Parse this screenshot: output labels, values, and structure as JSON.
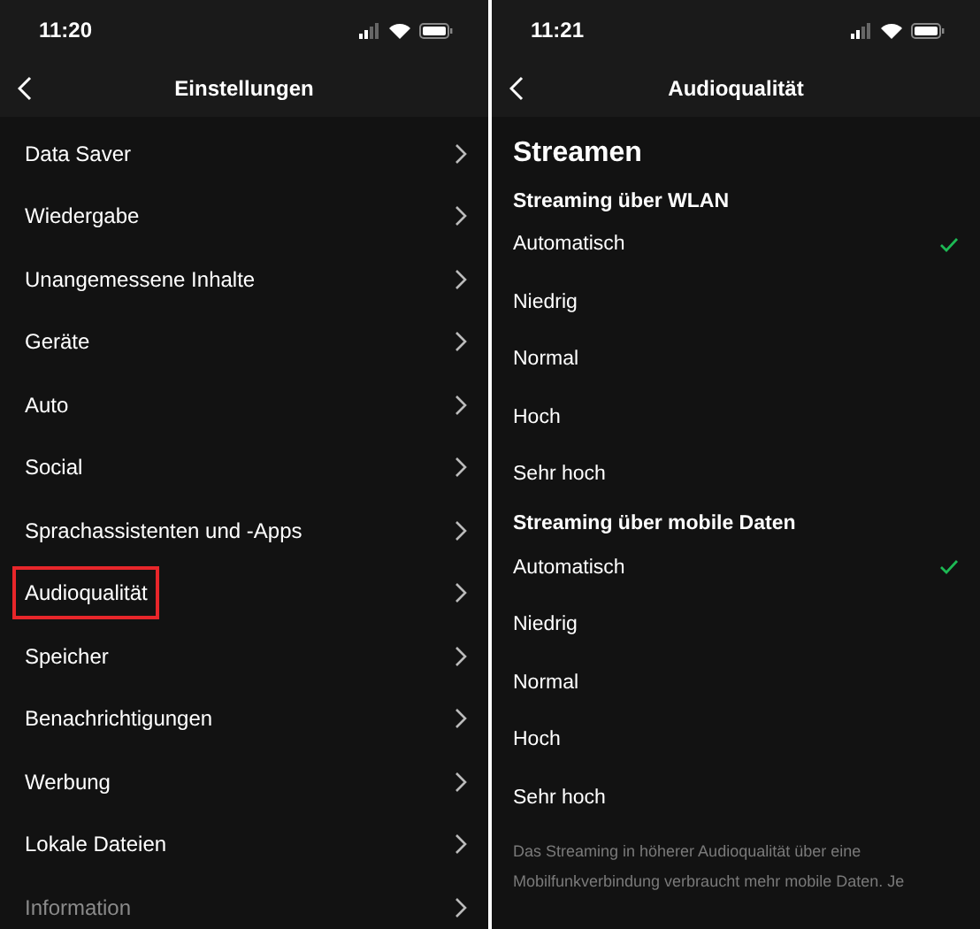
{
  "screens": [
    {
      "status_bar": {
        "time": "11:20"
      },
      "header": {
        "title": "Einstellungen"
      },
      "items": [
        {
          "label": "Data Saver",
          "highlighted": false,
          "dimmed": false
        },
        {
          "label": "Wiedergabe",
          "highlighted": false,
          "dimmed": false
        },
        {
          "label": "Unangemessene Inhalte",
          "highlighted": false,
          "dimmed": false
        },
        {
          "label": "Geräte",
          "highlighted": false,
          "dimmed": false
        },
        {
          "label": "Auto",
          "highlighted": false,
          "dimmed": false
        },
        {
          "label": "Social",
          "highlighted": false,
          "dimmed": false
        },
        {
          "label": "Sprachassistenten und -Apps",
          "highlighted": false,
          "dimmed": false
        },
        {
          "label": "Audioqualität",
          "highlighted": true,
          "dimmed": false
        },
        {
          "label": "Speicher",
          "highlighted": false,
          "dimmed": false
        },
        {
          "label": "Benachrichtigungen",
          "highlighted": false,
          "dimmed": false
        },
        {
          "label": "Werbung",
          "highlighted": false,
          "dimmed": false
        },
        {
          "label": "Lokale Dateien",
          "highlighted": false,
          "dimmed": false
        },
        {
          "label": "Information",
          "highlighted": false,
          "dimmed": true
        }
      ]
    },
    {
      "status_bar": {
        "time": "11:21"
      },
      "header": {
        "title": "Audioqualität"
      },
      "heading": "Streamen",
      "groups": [
        {
          "title": "Streaming über WLAN",
          "options": [
            {
              "label": "Automatisch",
              "selected": true
            },
            {
              "label": "Niedrig",
              "selected": false
            },
            {
              "label": "Normal",
              "selected": false
            },
            {
              "label": "Hoch",
              "selected": false
            },
            {
              "label": "Sehr hoch",
              "selected": false
            }
          ]
        },
        {
          "title": "Streaming über mobile Daten",
          "options": [
            {
              "label": "Automatisch",
              "selected": true
            },
            {
              "label": "Niedrig",
              "selected": false
            },
            {
              "label": "Normal",
              "selected": false
            },
            {
              "label": "Hoch",
              "selected": false
            },
            {
              "label": "Sehr hoch",
              "selected": false
            }
          ]
        }
      ],
      "note": "Das Streaming in höherer Audioqualität über eine Mobilfunkverbindung verbraucht mehr mobile Daten. Je"
    }
  ]
}
